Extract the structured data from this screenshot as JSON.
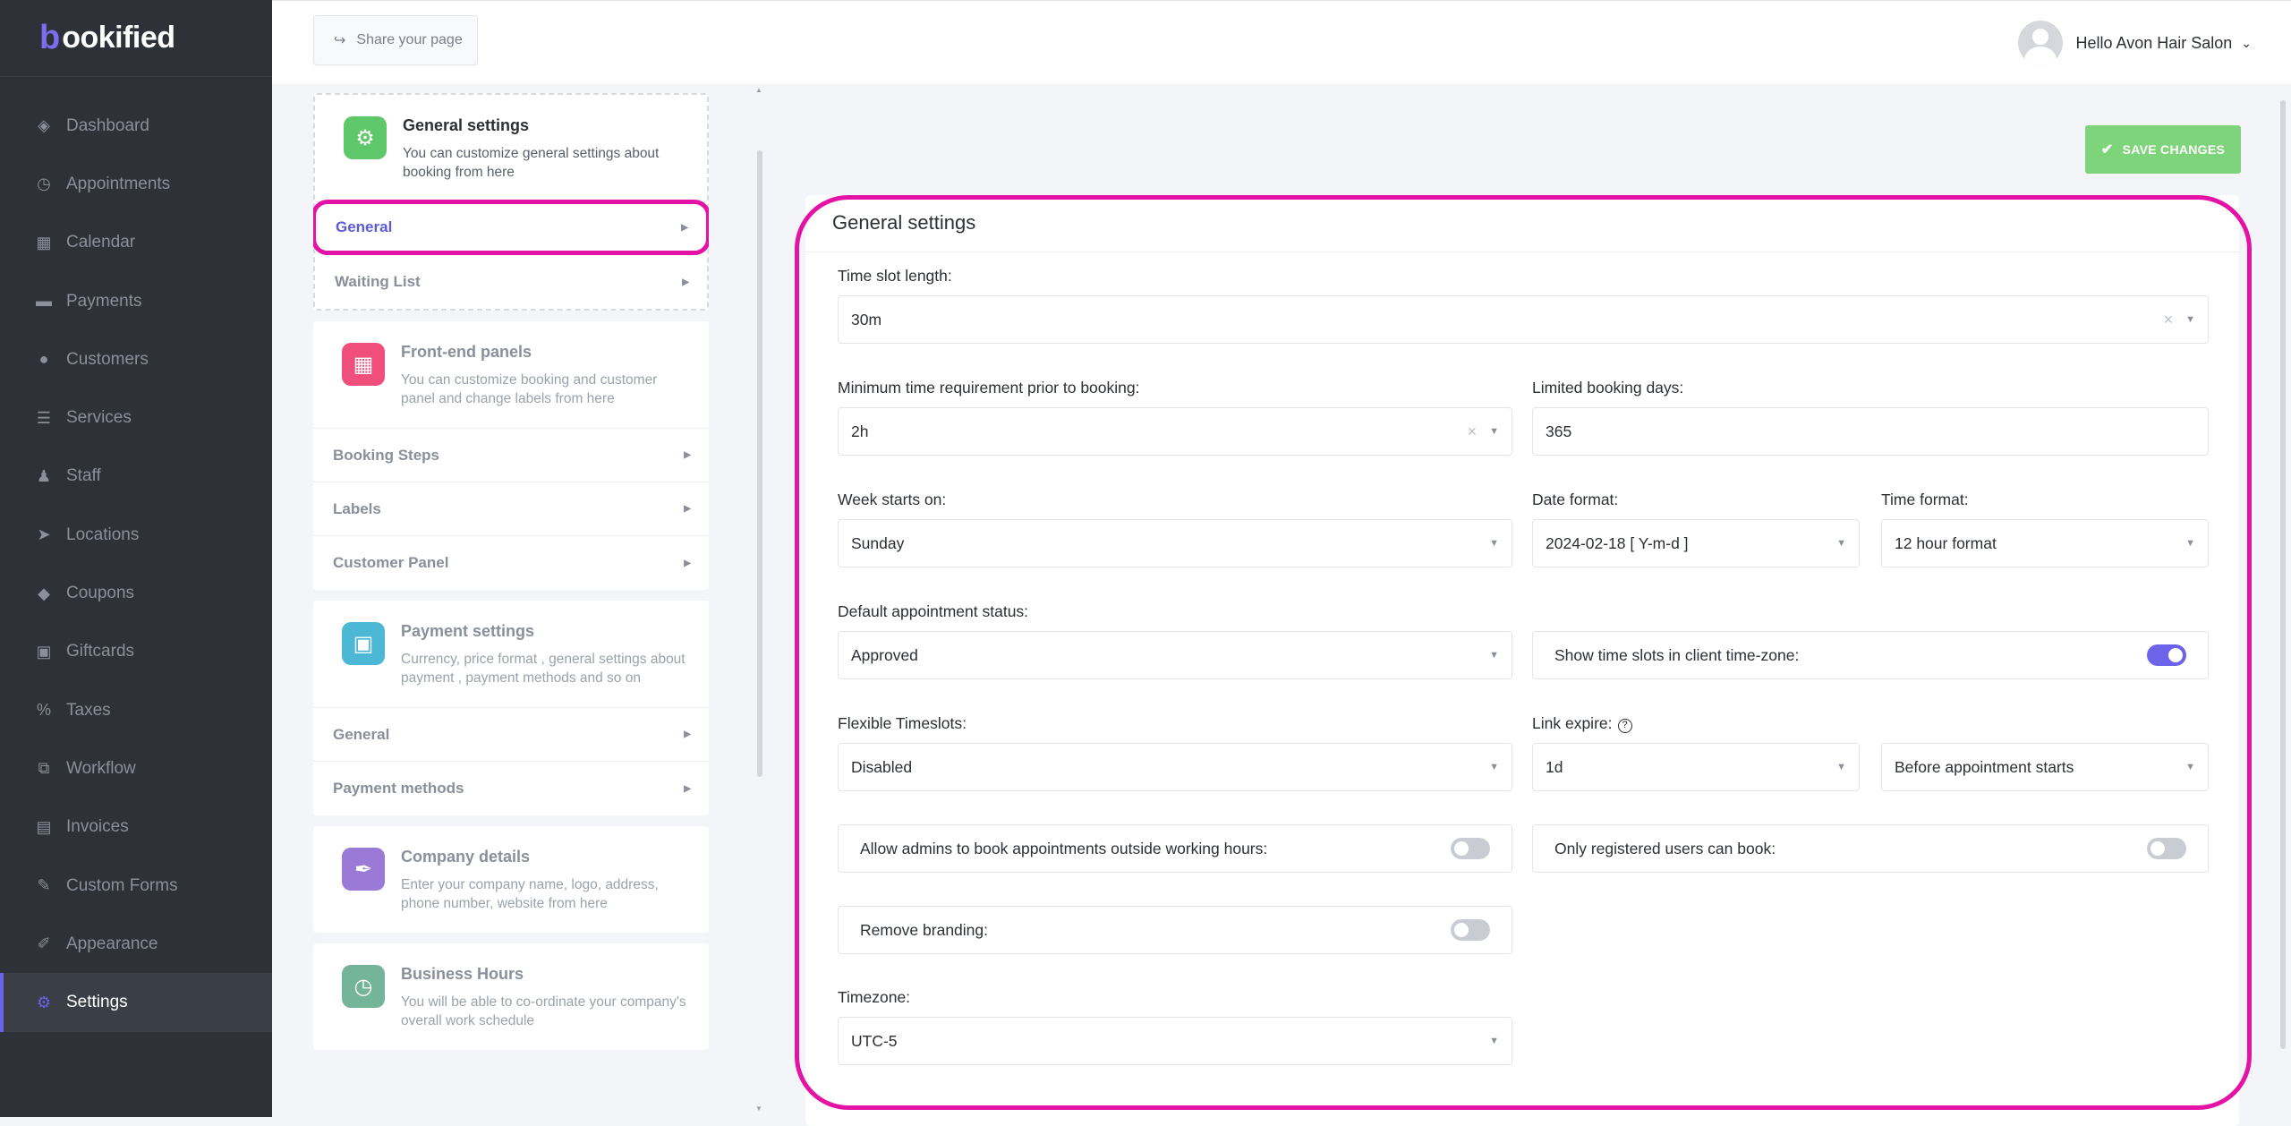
{
  "brand": {
    "mark": "b",
    "name": "ookified"
  },
  "sidebar": {
    "items": [
      {
        "label": "Dashboard",
        "icon": "cube-icon"
      },
      {
        "label": "Appointments",
        "icon": "clock-icon"
      },
      {
        "label": "Calendar",
        "icon": "calendar-icon"
      },
      {
        "label": "Payments",
        "icon": "wallet-icon"
      },
      {
        "label": "Customers",
        "icon": "users-icon"
      },
      {
        "label": "Services",
        "icon": "list-icon"
      },
      {
        "label": "Staff",
        "icon": "user-icon"
      },
      {
        "label": "Locations",
        "icon": "location-arrow-icon"
      },
      {
        "label": "Coupons",
        "icon": "tag-icon"
      },
      {
        "label": "Giftcards",
        "icon": "gift-icon"
      },
      {
        "label": "Taxes",
        "icon": "percent-icon"
      },
      {
        "label": "Workflow",
        "icon": "workflow-icon"
      },
      {
        "label": "Invoices",
        "icon": "file-icon"
      },
      {
        "label": "Custom Forms",
        "icon": "tools-icon"
      },
      {
        "label": "Appearance",
        "icon": "brush-icon"
      },
      {
        "label": "Settings",
        "icon": "gear-icon"
      }
    ]
  },
  "topbar": {
    "share_label": "Share your page",
    "greeting": "Hello Avon Hair Salon"
  },
  "left": {
    "general_card": {
      "title": "General settings",
      "desc": "You can customize general settings about booking from here",
      "items": [
        "General",
        "Waiting List"
      ]
    },
    "frontend_card": {
      "title": "Front-end panels",
      "desc": "You can customize booking and customer panel and change labels from here",
      "items": [
        "Booking Steps",
        "Labels",
        "Customer Panel"
      ]
    },
    "payment_card": {
      "title": "Payment settings",
      "desc": "Currency, price format , general settings about payment , payment methods and so on",
      "items": [
        "General",
        "Payment methods"
      ]
    },
    "company_card": {
      "title": "Company details",
      "desc": "Enter your company name, logo, address, phone number, website from here"
    },
    "hours_card": {
      "title": "Business Hours",
      "desc": "You will be able to co-ordinate your company's overall work schedule"
    }
  },
  "colors": {
    "accent": "#6c63e8",
    "save": "#7ed47a",
    "highlight": "#e413a5",
    "sidebar": "#2e3138"
  },
  "form": {
    "save_label": "SAVE CHANGES",
    "title": "General settings",
    "time_slot_label": "Time slot length:",
    "time_slot_value": "30m",
    "min_time_label": "Minimum time requirement prior to booking:",
    "min_time_value": "2h",
    "limited_days_label": "Limited booking days:",
    "limited_days_value": "365",
    "week_starts_label": "Week starts on:",
    "week_starts_value": "Sunday",
    "date_format_label": "Date format:",
    "date_format_value": "2024-02-18 [ Y-m-d ]",
    "time_format_label": "Time format:",
    "time_format_value": "12 hour format",
    "default_status_label": "Default appointment status:",
    "default_status_value": "Approved",
    "client_tz_label": "Show time slots in client time-zone:",
    "client_tz_on": true,
    "flexible_label": "Flexible Timeslots:",
    "flexible_value": "Disabled",
    "link_expire_label": "Link expire:",
    "link_expire_value": "1d",
    "link_expire_when": "Before appointment starts",
    "admins_outside_label": "Allow admins to book appointments outside working hours:",
    "admins_outside_on": false,
    "registered_only_label": "Only registered users can book:",
    "registered_only_on": false,
    "remove_branding_label": "Remove branding:",
    "remove_branding_on": false,
    "timezone_label": "Timezone:",
    "timezone_value": "UTC-5"
  }
}
